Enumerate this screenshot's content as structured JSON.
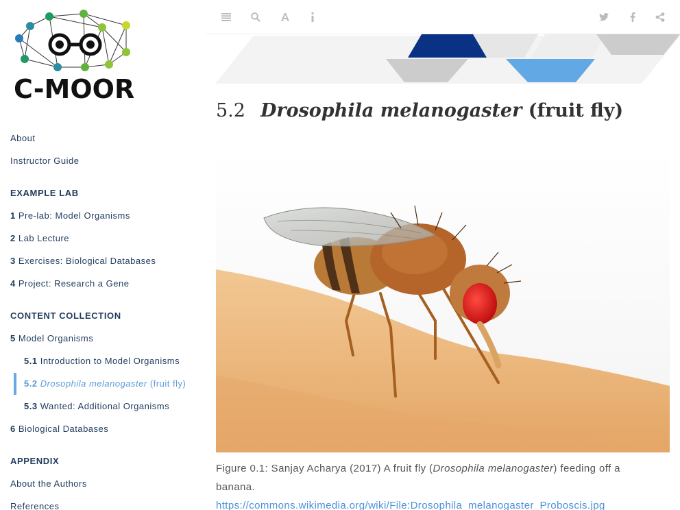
{
  "logo": {
    "text": "C-MOOR"
  },
  "sidebar": {
    "about": "About",
    "instructor_guide": "Instructor Guide",
    "example_lab_header": "EXAMPLE LAB",
    "example_lab": [
      {
        "num": "1",
        "label": "Pre-lab: Model Organisms"
      },
      {
        "num": "2",
        "label": "Lab Lecture"
      },
      {
        "num": "3",
        "label": "Exercises: Biological Databases"
      },
      {
        "num": "4",
        "label": "Project: Research a Gene"
      }
    ],
    "content_header": "CONTENT COLLECTION",
    "content": [
      {
        "num": "5",
        "label": "Model Organisms"
      },
      {
        "num": "5.1",
        "label": "Introduction to Model Organisms"
      },
      {
        "num": "5.2",
        "label_italic": "Drosophila melanogaster",
        "label": " (fruit fly)"
      },
      {
        "num": "5.3",
        "label": "Wanted: Additional Organisms"
      },
      {
        "num": "6",
        "label": "Biological Databases"
      }
    ],
    "appendix_header": "APPENDIX",
    "appendix": [
      {
        "label": "About the Authors"
      },
      {
        "label": "References"
      }
    ]
  },
  "toolbar": {
    "icons": [
      "menu-icon",
      "search-icon",
      "font-icon",
      "info-icon",
      "twitter-icon",
      "facebook-icon",
      "share-icon"
    ]
  },
  "content": {
    "section_num": "5.2",
    "title_italic": "Drosophila melanogaster",
    "title_rest": " (fruit fly)",
    "caption_pre": "Figure 0.1: Sanjay Acharya (2017) A fruit fly (",
    "caption_italic": "Drosophila melanogaster",
    "caption_post": ") feeding off a banana.",
    "caption_link": "https://commons.wikimedia.org/wiki/File:Drosophila_melanogaster_Proboscis.jpg"
  },
  "colors": {
    "nav_text": "#1f3b5c",
    "active": "#5d9bd6",
    "banner_navy": "#0a3284",
    "banner_blue": "#62a8e5",
    "link": "#4a90d9"
  }
}
